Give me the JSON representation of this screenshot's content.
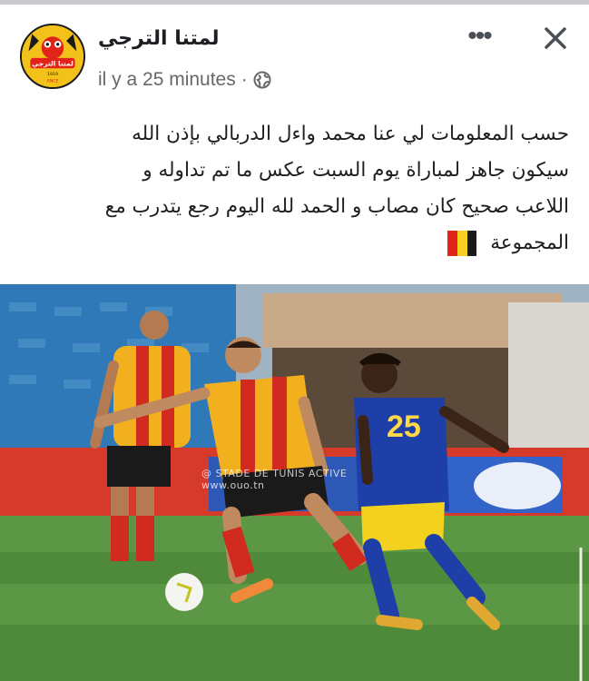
{
  "post": {
    "page_name": "لمتنا الترجي",
    "timestamp": "il y a 25 minutes",
    "separator": "·",
    "more_label": "•••",
    "text_lines": [
      "حسب المعلومات لي عنا محمد واءل الدربالي بإذن الله",
      "سيكون جاهز لمباراة يوم السبت عكس ما تم تداوله و",
      "اللاعب صحيح كان مصاب و الحمد لله اليوم رجع يتدرب مع",
      "المجموعة"
    ],
    "flag_colors": [
      "#1a1a1a",
      "#f5d020",
      "#e2231a"
    ]
  },
  "avatar": {
    "text": "لمتنا الترجي",
    "year": "1919",
    "sub": "ANCE"
  },
  "photo": {
    "watermark": "@ STADE DE TUNIS ACTIVE",
    "watermark_sub": "www.ouo.tn",
    "jersey_number": "25"
  },
  "colors": {
    "text_primary": "#1c1e21",
    "text_secondary": "#65676b",
    "pitch": "#4f8a3a",
    "home_red": "#d12a1f",
    "home_yellow": "#f2b01e",
    "away_blue": "#1f3fa8",
    "away_yellow": "#f2d21e"
  }
}
